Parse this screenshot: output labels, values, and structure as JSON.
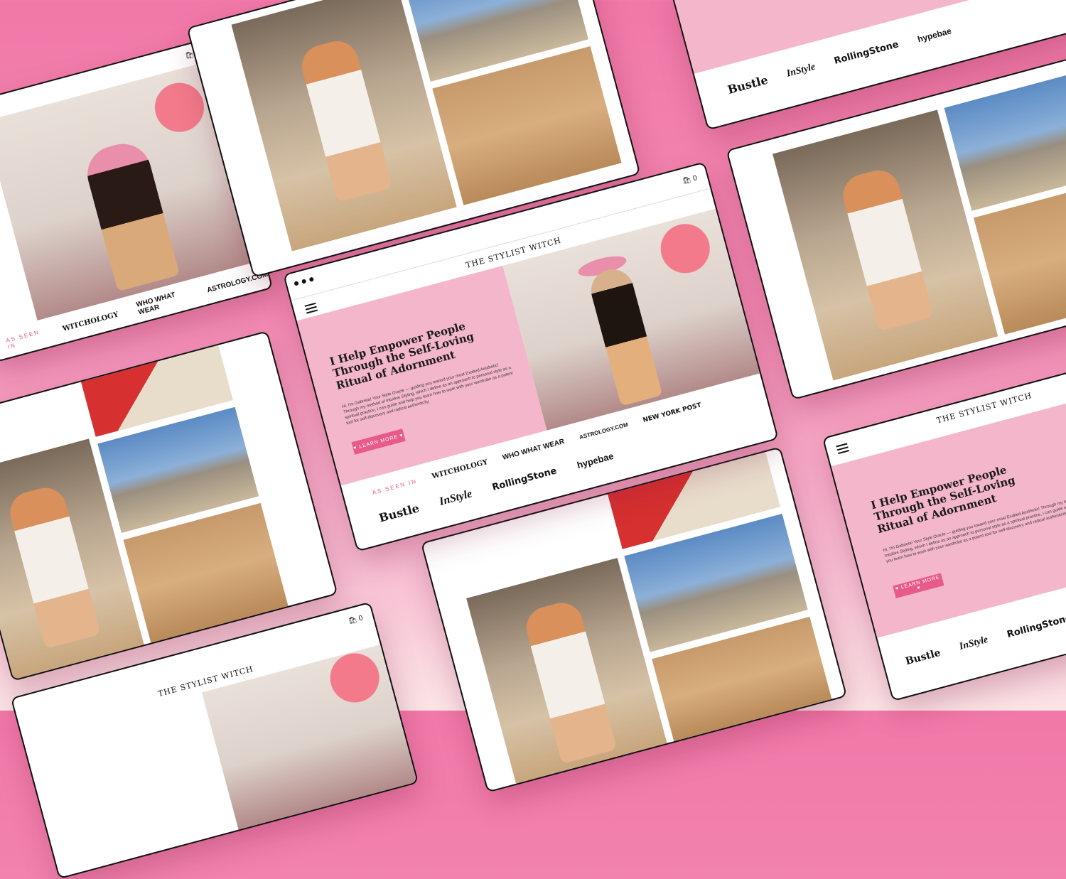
{
  "site": {
    "logo": "THE STYLIST WITCH",
    "cart_count": "0",
    "hero_title": "I Help Empower People Through the Self-Loving Ritual of Adornment",
    "hero_body": "Hi, I'm Gabriela! Your Style Oracle — guiding you toward your most Exalted Aesthetic! Through my method of Intuitive Styling, which I define as an approach to personal style as a spiritual practice, I can guide and help you learn how to work with your wardrobe as a potent tool for self-discovery and radical authenticity.",
    "cta_label": "♥ LEARN MORE ♥",
    "as_seen_in": "AS SEEN IN",
    "press": [
      "WITCHOLOGY",
      "WHO WHAT WEAR",
      "ASTROLOGY.COM",
      "NEW YORK POST",
      "hypebae",
      "RollingStone",
      "InStyle",
      "Bustle"
    ]
  },
  "colors": {
    "background_top": "#f178a8",
    "hero_pink": "#f4b6ca",
    "accent": "#e85a8a"
  },
  "icons": [
    "hamburger-menu-icon",
    "cart-icon",
    "heart-icon"
  ]
}
